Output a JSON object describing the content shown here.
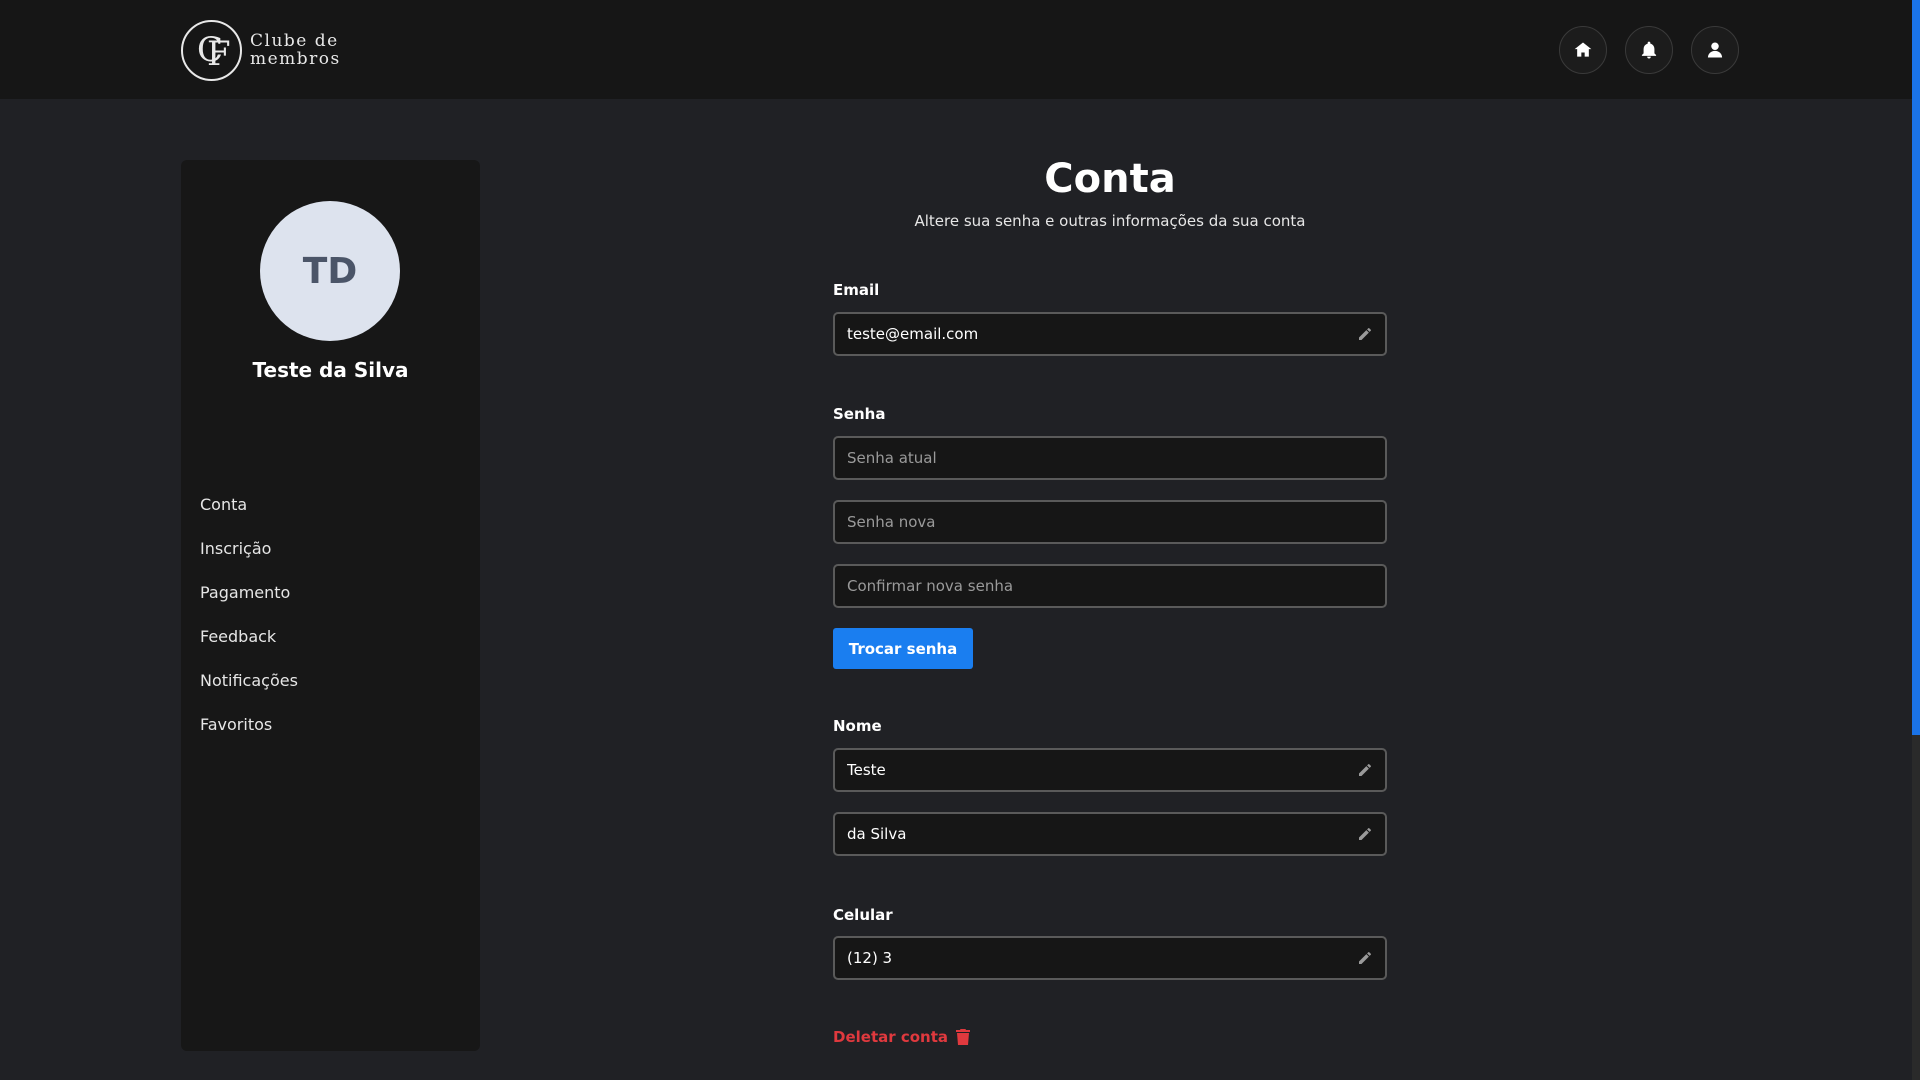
{
  "brand": {
    "line1": "Clube de",
    "line2": "membros",
    "mark": "CF"
  },
  "header": {
    "icons": [
      {
        "name": "home-icon"
      },
      {
        "name": "bell-icon"
      },
      {
        "name": "user-icon"
      }
    ]
  },
  "profile": {
    "initials": "TD",
    "name": "Teste da Silva"
  },
  "sidebar": {
    "items": [
      {
        "label": "Conta"
      },
      {
        "label": "Inscrição"
      },
      {
        "label": "Pagamento"
      },
      {
        "label": "Feedback"
      },
      {
        "label": "Notificações"
      },
      {
        "label": "Favoritos"
      }
    ]
  },
  "main": {
    "title": "Conta",
    "subtitle": "Altere sua senha e outras informações da sua conta",
    "email": {
      "label": "Email",
      "value": "teste@email.com"
    },
    "password": {
      "label": "Senha",
      "current_placeholder": "Senha atual",
      "new_placeholder": "Senha nova",
      "confirm_placeholder": "Confirmar nova senha",
      "button": "Trocar senha"
    },
    "name": {
      "label": "Nome",
      "first": "Teste",
      "last": "da Silva"
    },
    "phone": {
      "label": "Celular",
      "value": "(12) 3"
    },
    "delete": "Deletar conta"
  },
  "colors": {
    "accent": "#1a7ef0",
    "danger": "#e0393e",
    "background": "#202125"
  }
}
